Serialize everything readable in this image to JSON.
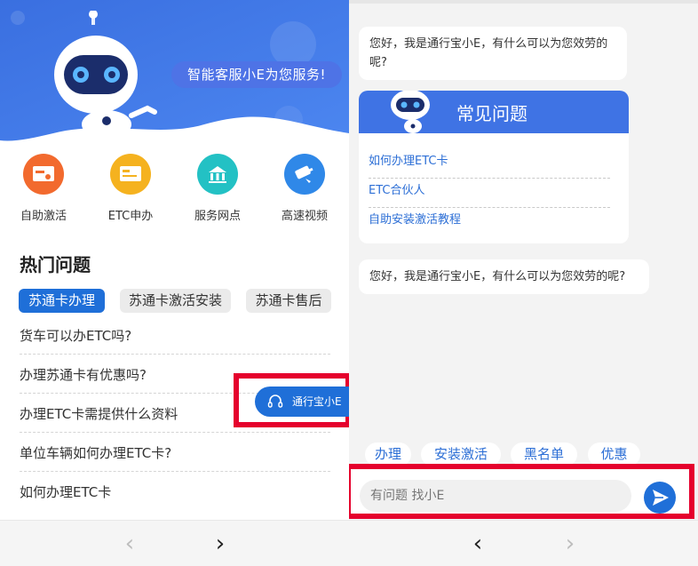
{
  "left": {
    "hero_text": "智能客服小E为您服务!",
    "features": [
      {
        "label": "自助激活",
        "icon": "self-activation-icon",
        "color": "#f26a2e"
      },
      {
        "label": "ETC申办",
        "icon": "etc-card-icon",
        "color": "#f5b21f"
      },
      {
        "label": "服务网点",
        "icon": "service-outlet-icon",
        "color": "#23c1c4"
      },
      {
        "label": "高速视频",
        "icon": "highway-video-icon",
        "color": "#2f88e8"
      }
    ],
    "hot_title": "热门问题",
    "tabs": [
      {
        "label": "苏通卡办理",
        "active": true
      },
      {
        "label": "苏通卡激活安装",
        "active": false
      },
      {
        "label": "苏通卡售后",
        "active": false
      }
    ],
    "questions": [
      "货车可以办ETC吗?",
      "办理苏通卡有优惠吗?",
      "办理ETC卡需提供什么资料",
      "单位车辆如何办理ETC卡?",
      "如何办理ETC卡"
    ],
    "float_button": "通行宝小E",
    "nav": {
      "back": "‹",
      "forward": "›"
    }
  },
  "right": {
    "greeting_1": "您好，我是通行宝小E，有什么可以为您效劳的呢?",
    "faq_title": "常见问题",
    "faq_links": [
      "如何办理ETC卡",
      "ETC合伙人",
      "自助安装激活教程"
    ],
    "greeting_2": "您好，我是通行宝小E，有什么可以为您效劳的呢?",
    "chips": [
      "办理",
      "安装激活",
      "黑名单",
      "优惠"
    ],
    "input_placeholder": "有问题 找小E",
    "nav": {
      "back": "‹",
      "forward": "›"
    }
  },
  "colors": {
    "primary": "#1f6fd8",
    "highlight": "#e5002d",
    "hero_blue": "#3f73e4"
  }
}
